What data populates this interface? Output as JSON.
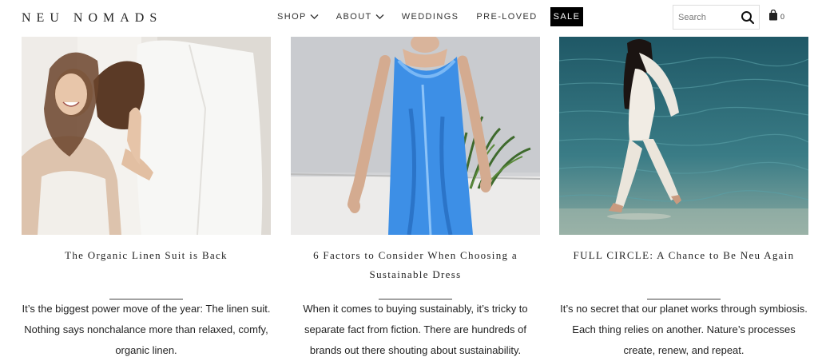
{
  "brand": {
    "logo": "NEU NOMADS"
  },
  "nav": {
    "items": [
      {
        "label": "SHOP",
        "has_dropdown": true
      },
      {
        "label": "ABOUT",
        "has_dropdown": true
      },
      {
        "label": "WEDDINGS",
        "has_dropdown": false
      },
      {
        "label": "PRE-LOVED",
        "has_dropdown": false
      },
      {
        "label": "SALE",
        "has_dropdown": false,
        "highlight": true
      }
    ]
  },
  "search": {
    "placeholder": "Search",
    "icon": "search-icon"
  },
  "cart": {
    "icon": "shopping-bag-icon",
    "count": "0"
  },
  "posts": [
    {
      "title": "The Organic Linen Suit is Back",
      "excerpt": "It’s the biggest power move of the year: The linen suit. Nothing says nonchalance more than relaxed, comfy, organic linen.",
      "image": "woman-laughing-white-linen-blazer"
    },
    {
      "title": "6 Factors to Consider When Choosing a Sustainable Dress",
      "excerpt": "When it comes to buying sustainably, it’s tricky to separate fact from fiction. There are hundreds of brands out there shouting about sustainability.",
      "image": "woman-blue-satin-slip-dress"
    },
    {
      "title": "FULL CIRCLE: A Chance to Be Neu Again",
      "excerpt": "It’s no secret that our planet works through symbiosis. Each thing relies on another. Nature’s processes create, renew, and repeat.",
      "image": "woman-white-suit-walking-in-water"
    }
  ],
  "colors": {
    "sale_bg": "#000000",
    "text": "#222222",
    "water": "#2f6f7e",
    "dress": "#3d8fe6"
  }
}
